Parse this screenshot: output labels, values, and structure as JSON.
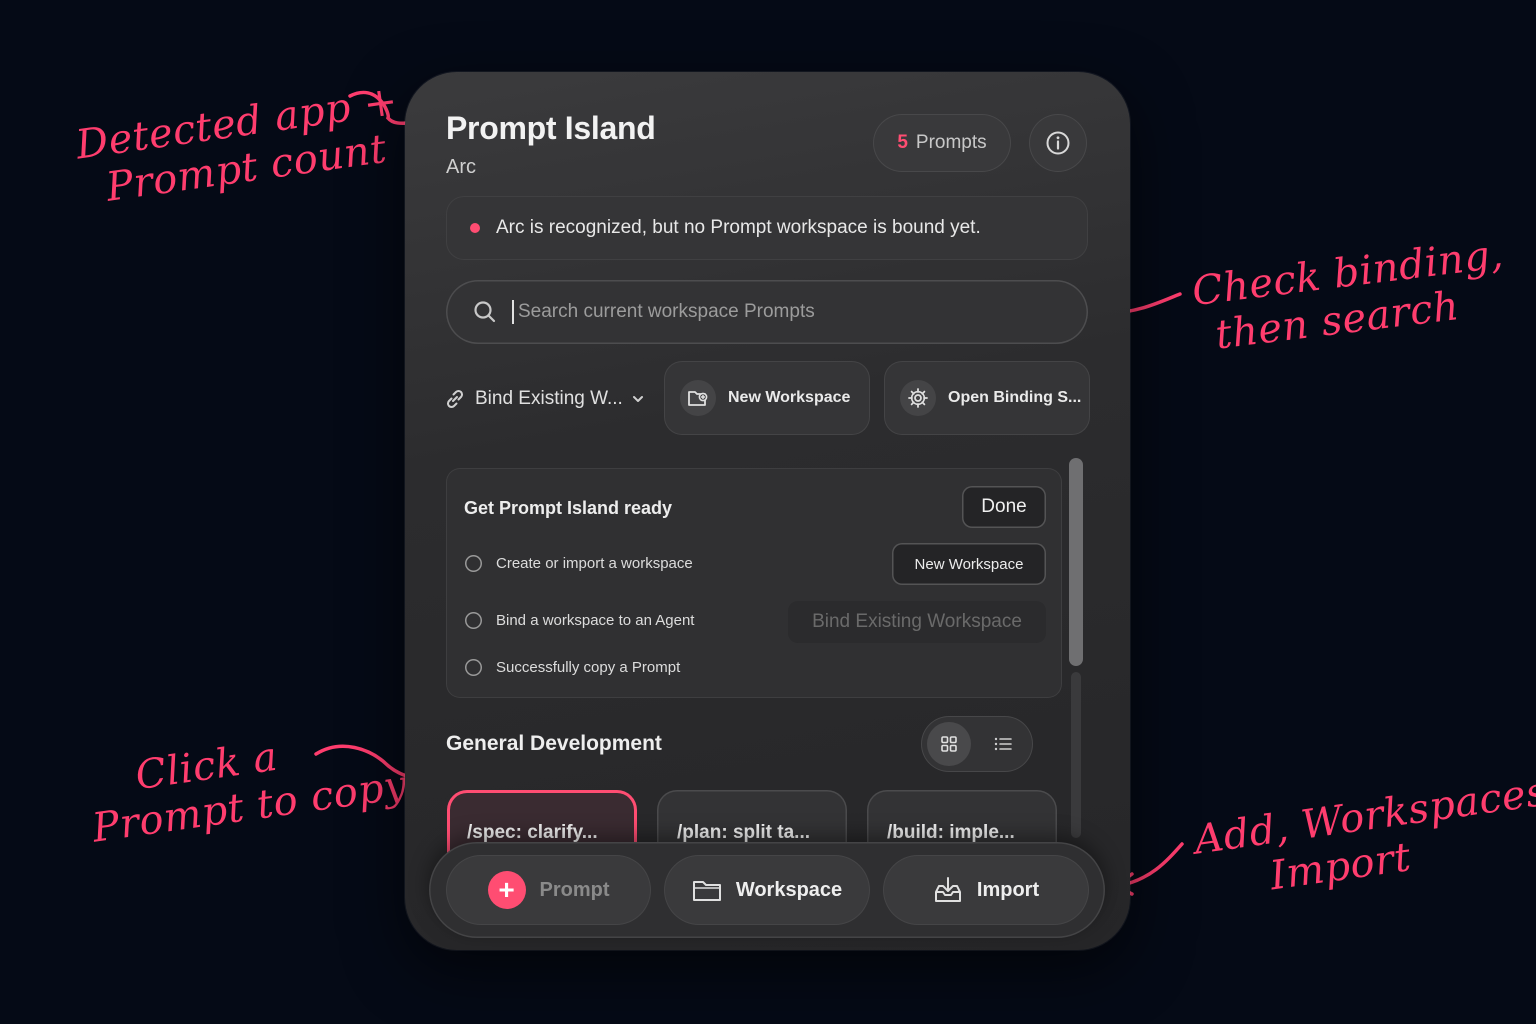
{
  "annotations": {
    "a1": [
      "Detected app +",
      "Prompt count"
    ],
    "a2": [
      "Check binding,",
      "then search"
    ],
    "a3": [
      "Click a",
      "Prompt to copy"
    ],
    "a4": [
      "Add, Workspaces,",
      "Import"
    ]
  },
  "header": {
    "title": "Prompt Island",
    "app_name": "Arc",
    "prompt_count": "5",
    "prompt_count_label": "Prompts"
  },
  "status": {
    "message": "Arc is recognized, but no Prompt workspace is bound yet."
  },
  "search": {
    "placeholder": "Search current workspace Prompts",
    "value": ""
  },
  "toolbar": {
    "bind_dropdown": "Bind Existing W...",
    "new_workspace": "New Workspace",
    "open_binding": "Open Binding S..."
  },
  "setup": {
    "title": "Get Prompt Island ready",
    "done_label": "Done",
    "tasks": [
      {
        "label": "Create or import a workspace",
        "action": "New Workspace",
        "action_enabled": true
      },
      {
        "label": "Bind a workspace to an Agent",
        "action": "Bind Existing Workspace",
        "action_enabled": false
      },
      {
        "label": "Successfully copy a Prompt"
      }
    ]
  },
  "section": {
    "title": "General Development",
    "view_mode": "grid",
    "cards": [
      "/spec: clarify...",
      "/plan: split ta...",
      "/build: imple..."
    ]
  },
  "bottom_bar": {
    "prompt": "Prompt",
    "workspace": "Workspace",
    "import": "Import"
  },
  "colors": {
    "accent": "#ff4d72",
    "background": "#050a16",
    "panel": "#2e2e30"
  }
}
